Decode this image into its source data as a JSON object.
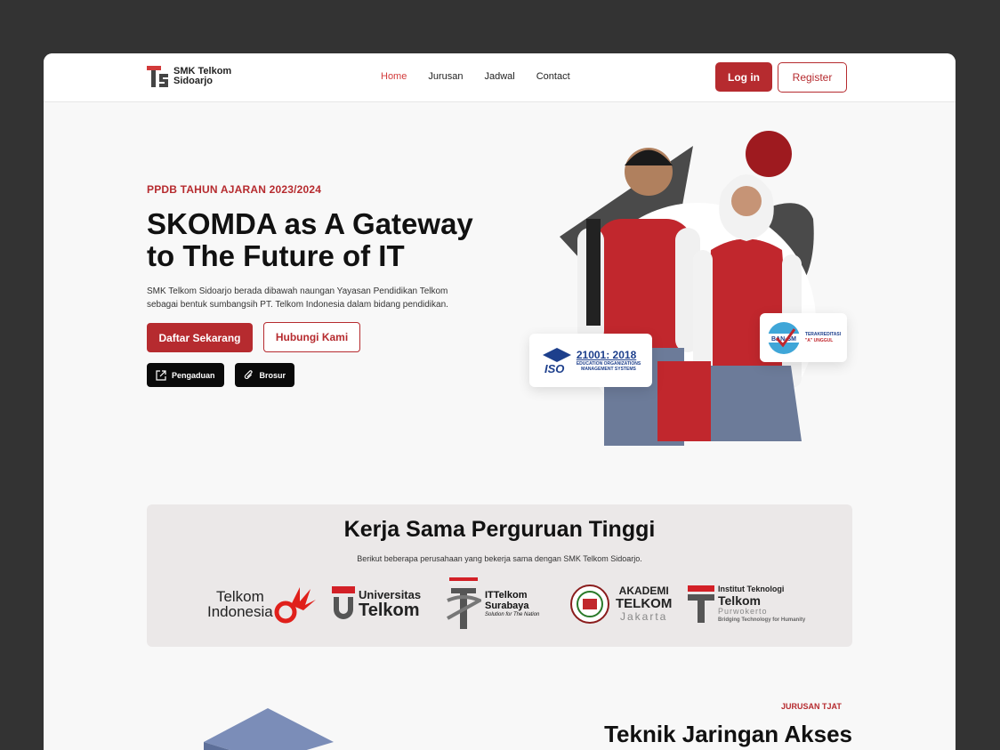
{
  "nav": {
    "logo_line1": "SMK Telkom",
    "logo_line2": "Sidoarjo",
    "menu": [
      {
        "label": "Home",
        "active": true
      },
      {
        "label": "Jurusan",
        "active": false
      },
      {
        "label": "Jadwal",
        "active": false
      },
      {
        "label": "Contact",
        "active": false
      }
    ],
    "login_label": "Log in",
    "register_label": "Register"
  },
  "hero": {
    "eyebrow": "PPDB TAHUN AJARAN 2023/2024",
    "title_line1": "SKOMDA as A Gateway",
    "title_line2": "to The Future of IT",
    "description": "SMK Telkom Sidoarjo berada dibawah naungan Yayasan Pendidikan Telkom sebagai bentuk sumbangsih PT. Telkom Indonesia dalam bidang pendidikan.",
    "primary_label": "Daftar Sekarang",
    "secondary_label": "Hubungi Kami",
    "pengaduan_label": "Pengaduan",
    "brosur_label": "Brosur",
    "iso_badge": {
      "word": "ISO",
      "number": "21001: 2018",
      "sub1": "EDUCATION ORGANIZATIONS",
      "sub2": "MANAGEMENT SYSTEMS"
    },
    "ban_badge": {
      "logo": "BAN-SM",
      "line1": "TERAKREDITASI",
      "line2": "\"A\" UNGGUL"
    }
  },
  "partners": {
    "title": "Kerja Sama Perguruan Tinggi",
    "subtitle": "Berikut beberapa perusahaan yang bekerja sama dengan SMK Telkom Sidoarjo.",
    "logos": {
      "telkom_indonesia": {
        "line1": "Telkom",
        "line2": "Indonesia"
      },
      "univ_telkom": {
        "line1": "Universitas",
        "line2": "Telkom"
      },
      "ittelkom_sby": {
        "line1": "ITTelkom",
        "line2": "Surabaya",
        "tagline": "Solution for The Nation"
      },
      "akademi_telkom": {
        "line1": "AKADEMI",
        "line2": "TELKOM",
        "line3": "Jakarta"
      },
      "ittelkom_pwt": {
        "line1": "Institut Teknologi",
        "line2": "Telkom",
        "line3": "Purwokerto",
        "tagline": "Bridging Technology for Humanity"
      }
    }
  },
  "jurusan": {
    "eyebrow": "JURUSAN TJAT",
    "title": "Teknik Jaringan Akses"
  },
  "colors": {
    "brand": "#b62b2f",
    "frame_bg": "#f8f8f8",
    "outer_bg": "#333333"
  }
}
